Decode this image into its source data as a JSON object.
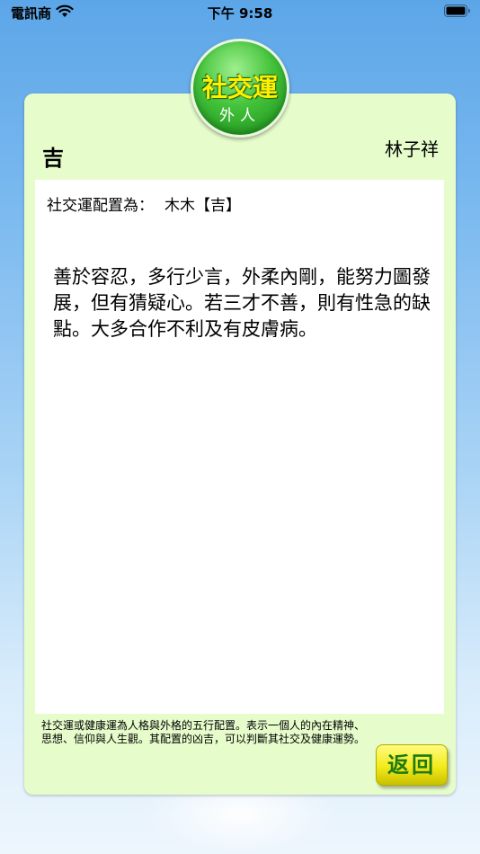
{
  "status_bar": {
    "carrier": "電訊商",
    "time": "下午 9:58"
  },
  "badge": {
    "title": "社交運",
    "subtitle": "外人"
  },
  "header": {
    "rating": "吉",
    "name": "林子祥"
  },
  "config": {
    "label": "社交運配置為：",
    "value": "木木【吉】"
  },
  "description": "善於容忍，多行少言，外柔內剛，能努力圖發展，但有猜疑心。若三才不善，則有性急的缺點。大多合作不利及有皮膚病。",
  "footnote": "社交運或健康運為人格與外格的五行配置。表示一個人的內在精神、思想、信仰與人生觀。其配置的凶吉，可以判斷其社交及健康運勢。",
  "back_button": "返回",
  "colors": {
    "card_background": "#e6fccb",
    "badge_green": "#43c23a",
    "badge_text": "#fff000",
    "button_yellow": "#f3ea1a",
    "button_text": "#1d7a10"
  },
  "icons": [
    "wifi-icon",
    "battery-icon"
  ]
}
